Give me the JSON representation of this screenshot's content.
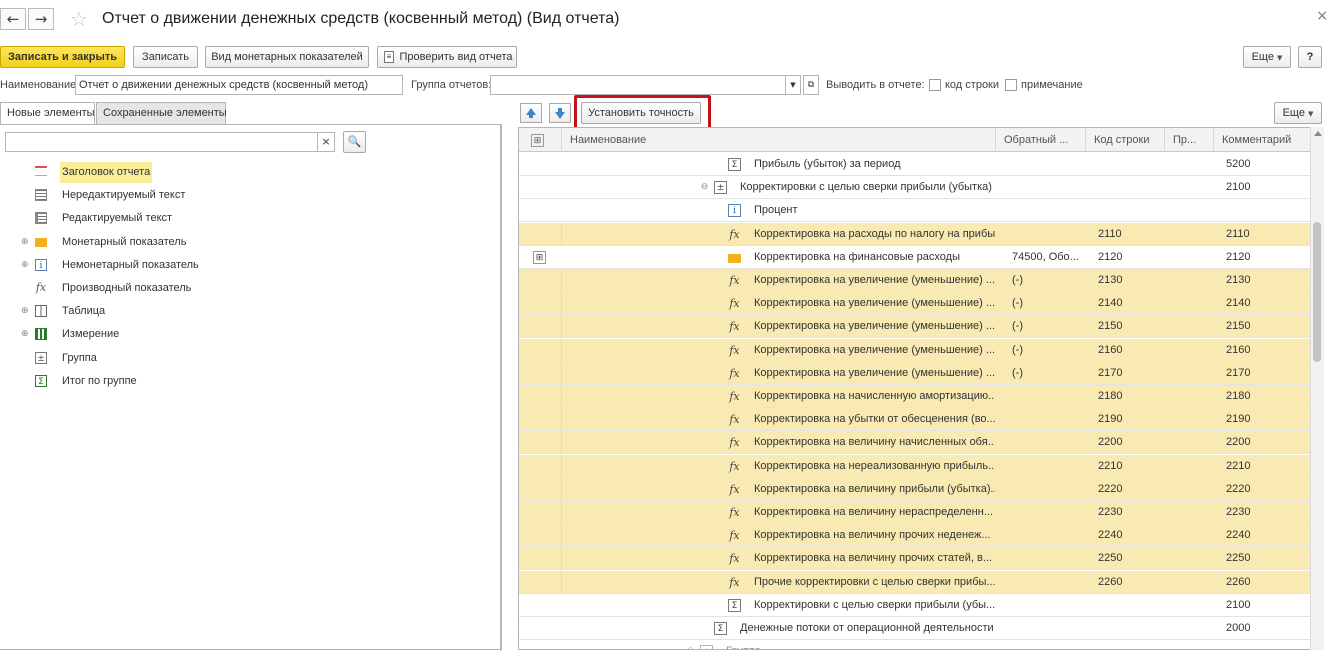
{
  "window": {
    "title": "Отчет о движении денежных средств (косвенный метод) (Вид отчета)",
    "back": "←",
    "forward": "→",
    "star": "☆",
    "close": "×"
  },
  "toolbar": {
    "save_close": "Записать и закрыть",
    "save": "Записать",
    "monetary_view": "Вид монетарных показателей",
    "check_view": "Проверить вид отчета",
    "more": "Еще",
    "help": "?"
  },
  "form": {
    "name_label": "Наименование:",
    "name_value": "Отчет о движении денежных средств (косвенный метод)",
    "group_label": "Группа отчетов:",
    "group_value": "",
    "show_label": "Выводить в отчете:",
    "row_code_label": "код строки",
    "note_label": "примечание"
  },
  "tabs": [
    {
      "label": "Новые элементы",
      "active": true
    },
    {
      "label": "Сохраненные элементы",
      "active": false
    }
  ],
  "left": {
    "search_placeholder": "",
    "clear": "×",
    "items": [
      {
        "label": "Заголовок отчета",
        "icon": "title-icon",
        "expandable": false,
        "selected": true
      },
      {
        "label": "Нередактируемый текст",
        "icon": "text-readonly-icon",
        "expandable": false,
        "selected": false
      },
      {
        "label": "Редактируемый текст",
        "icon": "text-editable-icon",
        "expandable": false,
        "selected": false
      },
      {
        "label": "Монетарный показатель",
        "icon": "monetary-icon",
        "expandable": true,
        "selected": false
      },
      {
        "label": "Немонетарный показатель",
        "icon": "info-icon",
        "expandable": true,
        "selected": false
      },
      {
        "label": "Производный показатель",
        "icon": "fx-icon",
        "expandable": false,
        "selected": false
      },
      {
        "label": "Таблица",
        "icon": "table-icon",
        "expandable": true,
        "selected": false
      },
      {
        "label": "Измерение",
        "icon": "dimension-icon",
        "expandable": true,
        "selected": false
      },
      {
        "label": "Группа",
        "icon": "group-icon",
        "expandable": false,
        "selected": false
      },
      {
        "label": "Итог по группе",
        "icon": "sum-icon",
        "expandable": false,
        "selected": false
      }
    ]
  },
  "right": {
    "set_precision": "Установить точность",
    "more": "Еще",
    "columns": [
      "Наименование",
      "Обратный ...",
      "Код строки",
      "Пр...",
      "Комментарий"
    ],
    "rows": [
      {
        "icon": "sum-icon",
        "level": 2,
        "name": "Прибыль (убыток) за период",
        "reverse": "",
        "code": "",
        "comment": "5200",
        "hl": false,
        "mark": false,
        "collapse": false
      },
      {
        "icon": "group-icon",
        "level": 1,
        "name": "Корректировки с целью сверки прибыли (убытка)",
        "reverse": "",
        "code": "",
        "comment": "2100",
        "hl": false,
        "mark": false,
        "collapse": true
      },
      {
        "icon": "info-icon",
        "level": 2,
        "name": "Процент",
        "reverse": "",
        "code": "",
        "comment": "",
        "hl": false,
        "mark": false,
        "collapse": false
      },
      {
        "icon": "fx-icon",
        "level": 2,
        "name": "Корректировка на расходы по налогу на прибыль",
        "reverse": "",
        "code": "2110",
        "comment": "2110",
        "hl": true,
        "mark": false,
        "collapse": false
      },
      {
        "icon": "monetary-icon",
        "level": 2,
        "name": "Корректировка на финансовые расходы",
        "reverse": "74500, Обо...",
        "code": "2120",
        "comment": "2120",
        "hl": false,
        "mark": true,
        "collapse": false
      },
      {
        "icon": "fx-icon",
        "level": 2,
        "name": "Корректировка на увеличение (уменьшение) ...",
        "reverse": "(-)",
        "code": "2130",
        "comment": "2130",
        "hl": true,
        "mark": false,
        "collapse": false
      },
      {
        "icon": "fx-icon",
        "level": 2,
        "name": "Корректировка на увеличение (уменьшение) ...",
        "reverse": "(-)",
        "code": "2140",
        "comment": "2140",
        "hl": true,
        "mark": false,
        "collapse": false
      },
      {
        "icon": "fx-icon",
        "level": 2,
        "name": "Корректировка на увеличение (уменьшение) ...",
        "reverse": "(-)",
        "code": "2150",
        "comment": "2150",
        "hl": true,
        "mark": false,
        "collapse": false
      },
      {
        "icon": "fx-icon",
        "level": 2,
        "name": "Корректировка на увеличение (уменьшение) ...",
        "reverse": "(-)",
        "code": "2160",
        "comment": "2160",
        "hl": true,
        "mark": false,
        "collapse": false
      },
      {
        "icon": "fx-icon",
        "level": 2,
        "name": "Корректировка на увеличение (уменьшение) ...",
        "reverse": "(-)",
        "code": "2170",
        "comment": "2170",
        "hl": true,
        "mark": false,
        "collapse": false
      },
      {
        "icon": "fx-icon",
        "level": 2,
        "name": "Корректировка на начисленную амортизацию...",
        "reverse": "",
        "code": "2180",
        "comment": "2180",
        "hl": true,
        "mark": false,
        "collapse": false
      },
      {
        "icon": "fx-icon",
        "level": 2,
        "name": "Корректировка на убытки от обесценения (во...",
        "reverse": "",
        "code": "2190",
        "comment": "2190",
        "hl": true,
        "mark": false,
        "collapse": false
      },
      {
        "icon": "fx-icon",
        "level": 2,
        "name": "Корректировка на величину начисленных обя...",
        "reverse": "",
        "code": "2200",
        "comment": "2200",
        "hl": true,
        "mark": false,
        "collapse": false
      },
      {
        "icon": "fx-icon",
        "level": 2,
        "name": "Корректировка на нереализованную прибыль...",
        "reverse": "",
        "code": "2210",
        "comment": "2210",
        "hl": true,
        "mark": false,
        "collapse": false
      },
      {
        "icon": "fx-icon",
        "level": 2,
        "name": "Корректировка на величину прибыли (убытка)...",
        "reverse": "",
        "code": "2220",
        "comment": "2220",
        "hl": true,
        "mark": false,
        "collapse": false
      },
      {
        "icon": "fx-icon",
        "level": 2,
        "name": "Корректировка на величину нераспределенн...",
        "reverse": "",
        "code": "2230",
        "comment": "2230",
        "hl": true,
        "mark": false,
        "collapse": false
      },
      {
        "icon": "fx-icon",
        "level": 2,
        "name": "Корректировка на величину прочих неденеж...",
        "reverse": "",
        "code": "2240",
        "comment": "2240",
        "hl": true,
        "mark": false,
        "collapse": false
      },
      {
        "icon": "fx-icon",
        "level": 2,
        "name": "Корректировка на величину прочих статей, в...",
        "reverse": "",
        "code": "2250",
        "comment": "2250",
        "hl": true,
        "mark": false,
        "collapse": false
      },
      {
        "icon": "fx-icon",
        "level": 2,
        "name": "Прочие корректировки с целью сверки прибы...",
        "reverse": "",
        "code": "2260",
        "comment": "2260",
        "hl": true,
        "mark": false,
        "collapse": false
      },
      {
        "icon": "sum-icon",
        "level": 2,
        "name": "Корректировки с целью сверки прибыли (убы...",
        "reverse": "",
        "code": "",
        "comment": "2100",
        "hl": false,
        "mark": false,
        "collapse": false
      },
      {
        "icon": "sum-icon",
        "level": 1,
        "name": "Денежные потоки от операционной деятельности",
        "reverse": "",
        "code": "",
        "comment": "2000",
        "hl": false,
        "mark": false,
        "collapse": false
      },
      {
        "icon": "group-icon",
        "level": 0,
        "name": "Группа",
        "reverse": "",
        "code": "",
        "comment": "",
        "hl": false,
        "mark": false,
        "collapse": true
      }
    ]
  },
  "colors": {
    "accent_yellow": "#f3cf1a",
    "row_highlight": "#f9eab3",
    "selection": "#fbec9a",
    "callout_red": "#c0141c",
    "arrow_blue": "#3d86c8"
  }
}
